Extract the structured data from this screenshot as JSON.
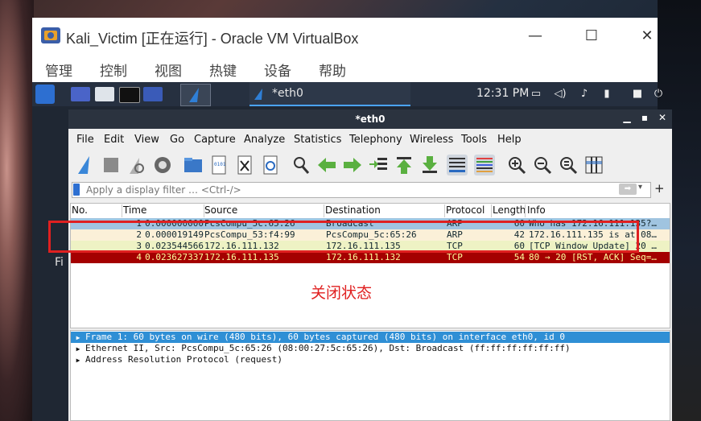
{
  "host": {
    "title": "Kali_Victim [正在运行] - Oracle VM VirtualBox",
    "menu": [
      "管理",
      "控制",
      "视图",
      "热键",
      "设备",
      "帮助"
    ],
    "desktop_text": "Fi"
  },
  "kali_panel": {
    "task_label": "*eth0",
    "clock": "12:31 PM"
  },
  "wireshark": {
    "window_title": "*eth0",
    "menu": [
      "File",
      "Edit",
      "View",
      "Go",
      "Capture",
      "Analyze",
      "Statistics",
      "Telephony",
      "Wireless",
      "Tools",
      "Help"
    ],
    "filter_placeholder": "Apply a display filter … <Ctrl-/>",
    "columns": [
      "No.",
      "Time",
      "Source",
      "Destination",
      "Protocol",
      "Length",
      "Info"
    ],
    "packets": [
      {
        "no": "1",
        "time": "0.000000000",
        "src": "PcsCompu_5c:65:26",
        "dst": "Broadcast",
        "proto": "ARP",
        "len": "60",
        "info": "Who has 172.16.111.135?…",
        "bg": "#a0c4e0",
        "fg": "#12272e"
      },
      {
        "no": "2",
        "time": "0.000019149",
        "src": "PcsCompu_53:f4:99",
        "dst": "PcsCompu_5c:65:26",
        "proto": "ARP",
        "len": "42",
        "info": "172.16.111.135 is at 08…",
        "bg": "#fbf0d8",
        "fg": "#12272e"
      },
      {
        "no": "3",
        "time": "0.023544566",
        "src": "172.16.111.132",
        "dst": "172.16.111.135",
        "proto": "TCP",
        "len": "60",
        "info": "[TCP Window Update] 20 …",
        "bg": "#eef2c4",
        "fg": "#12272e"
      },
      {
        "no": "4",
        "time": "0.023627337",
        "src": "172.16.111.135",
        "dst": "172.16.111.132",
        "proto": "TCP",
        "len": "54",
        "info": "80 → 20 [RST, ACK] Seq=…",
        "bg": "#a40000",
        "fg": "#fffc9c"
      }
    ],
    "details": [
      "Frame 1: 60 bytes on wire (480 bits), 60 bytes captured (480 bits) on interface eth0, id 0",
      "Ethernet II, Src: PcsCompu_5c:65:26 (08:00:27:5c:65:26), Dst: Broadcast (ff:ff:ff:ff:ff:ff)",
      "Address Resolution Protocol (request)"
    ]
  },
  "annotation": "关闭状态"
}
